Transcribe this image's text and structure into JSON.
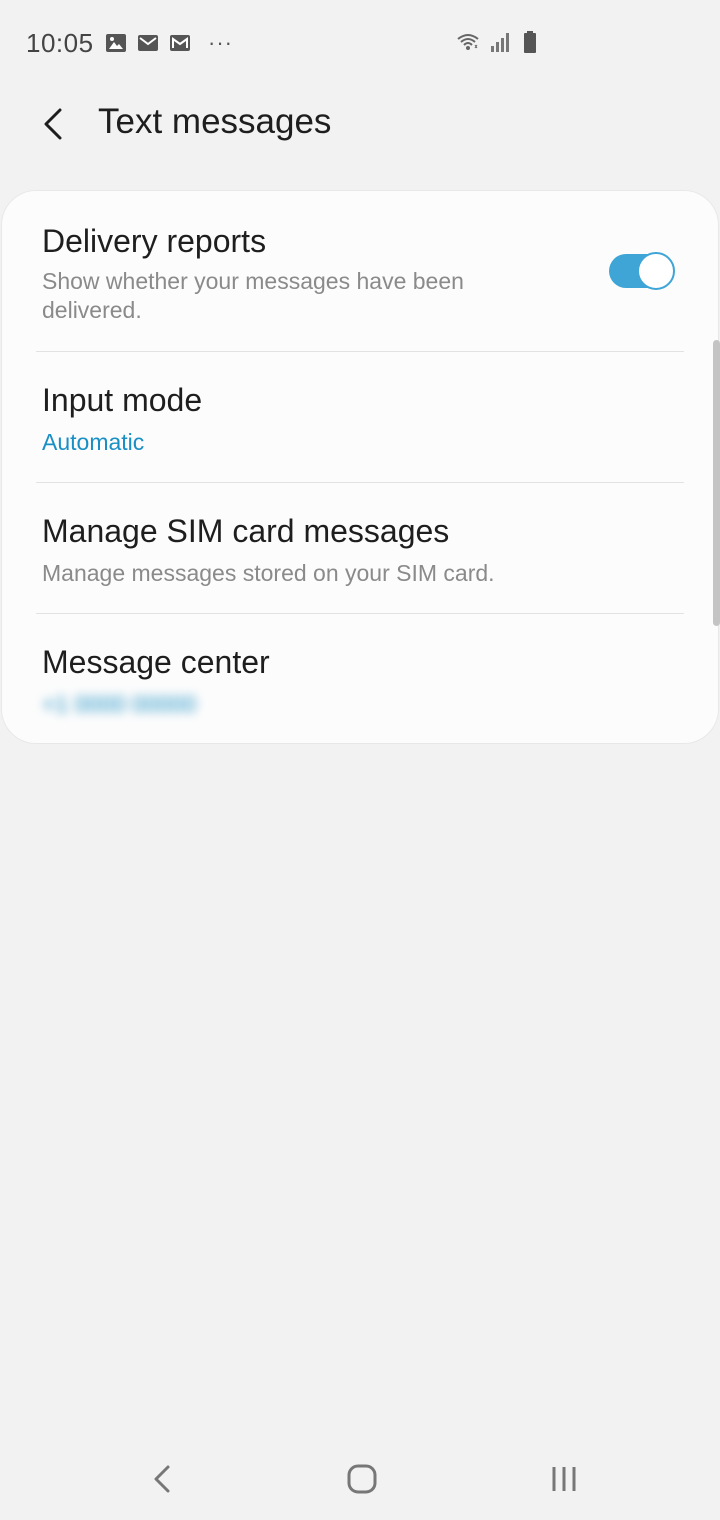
{
  "status_bar": {
    "time": "10:05",
    "overflow": "···",
    "left_icons": [
      "gallery-icon",
      "mail-icon",
      "gmail-icon",
      "more-icon"
    ],
    "right_icons": [
      "wifi-icon",
      "signal-icon",
      "battery-icon"
    ]
  },
  "header": {
    "title": "Text messages",
    "back_icon": "chevron-left-icon"
  },
  "settings": {
    "delivery_reports": {
      "title": "Delivery reports",
      "subtitle": "Show whether your messages have been delivered.",
      "toggle_on": true
    },
    "input_mode": {
      "title": "Input mode",
      "value": "Automatic"
    },
    "manage_sim": {
      "title": "Manage SIM card messages",
      "subtitle": "Manage messages stored on your SIM card."
    },
    "message_center": {
      "title": "Message center",
      "value": "+1 0000 00000",
      "value_obscured": true
    }
  },
  "nav_bar": {
    "buttons": [
      "back-nav-icon",
      "home-nav-icon",
      "recents-nav-icon"
    ]
  },
  "colors": {
    "accent": "#1a8fc4",
    "toggle": "#3ea5d6",
    "background": "#f2f2f2",
    "card": "#fcfcfc"
  }
}
